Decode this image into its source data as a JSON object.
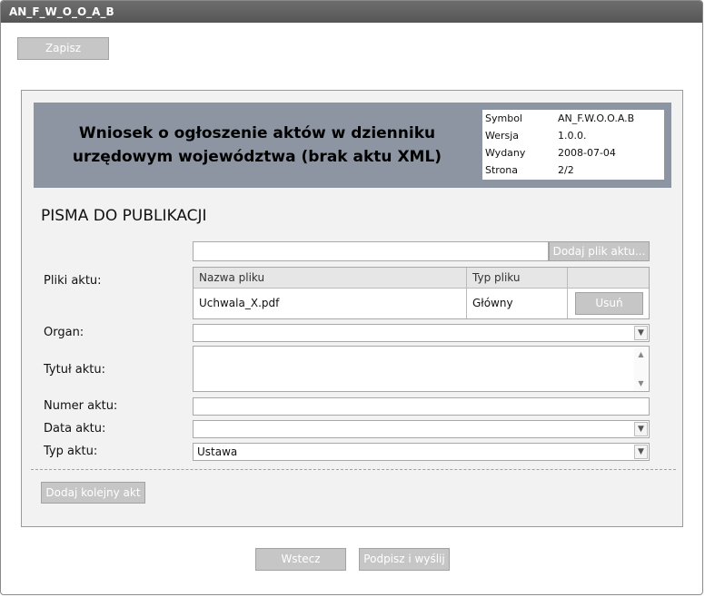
{
  "window": {
    "title": "AN_F_W_O_O_A_B"
  },
  "toolbar": {
    "save_label": "Zapisz"
  },
  "header": {
    "title_line1": "Wniosek o ogłoszenie aktów w dzienniku",
    "title_line2": "urzędowym województwa (brak aktu XML)",
    "meta": [
      {
        "key": "Symbol",
        "value": "AN_F.W.O.O.A.B"
      },
      {
        "key": "Wersja",
        "value": "1.0.0."
      },
      {
        "key": "Wydany",
        "value": "2008-07-04"
      },
      {
        "key": "Strona",
        "value": "2/2"
      }
    ],
    "background_color": "#8c95a1"
  },
  "section": {
    "title": "PISMA DO PUBLIKACJI"
  },
  "files": {
    "label": "Pliki aktu:",
    "path_value": "",
    "add_button": "Dodaj plik aktu...",
    "columns": [
      "Nazwa pliku",
      "Typ pliku"
    ],
    "rows": [
      {
        "name": "Uchwala_X.pdf",
        "type": "Główny",
        "remove_label": "Usuń"
      }
    ]
  },
  "form": {
    "organ": {
      "label": "Organ:",
      "value": ""
    },
    "title": {
      "label": "Tytuł aktu:",
      "value": ""
    },
    "number": {
      "label": "Numer aktu:",
      "value": ""
    },
    "date": {
      "label": "Data aktu:",
      "value": ""
    },
    "type": {
      "label": "Typ aktu:",
      "value": "Ustawa"
    }
  },
  "actions": {
    "add_another": "Dodaj kolejny akt",
    "back": "Wstecz",
    "sign_send": "Podpisz i wyślij"
  },
  "icons": {
    "dropdown": "chevron-down-icon",
    "scroll_up": "arrow-up-icon",
    "scroll_down": "arrow-down-icon"
  }
}
